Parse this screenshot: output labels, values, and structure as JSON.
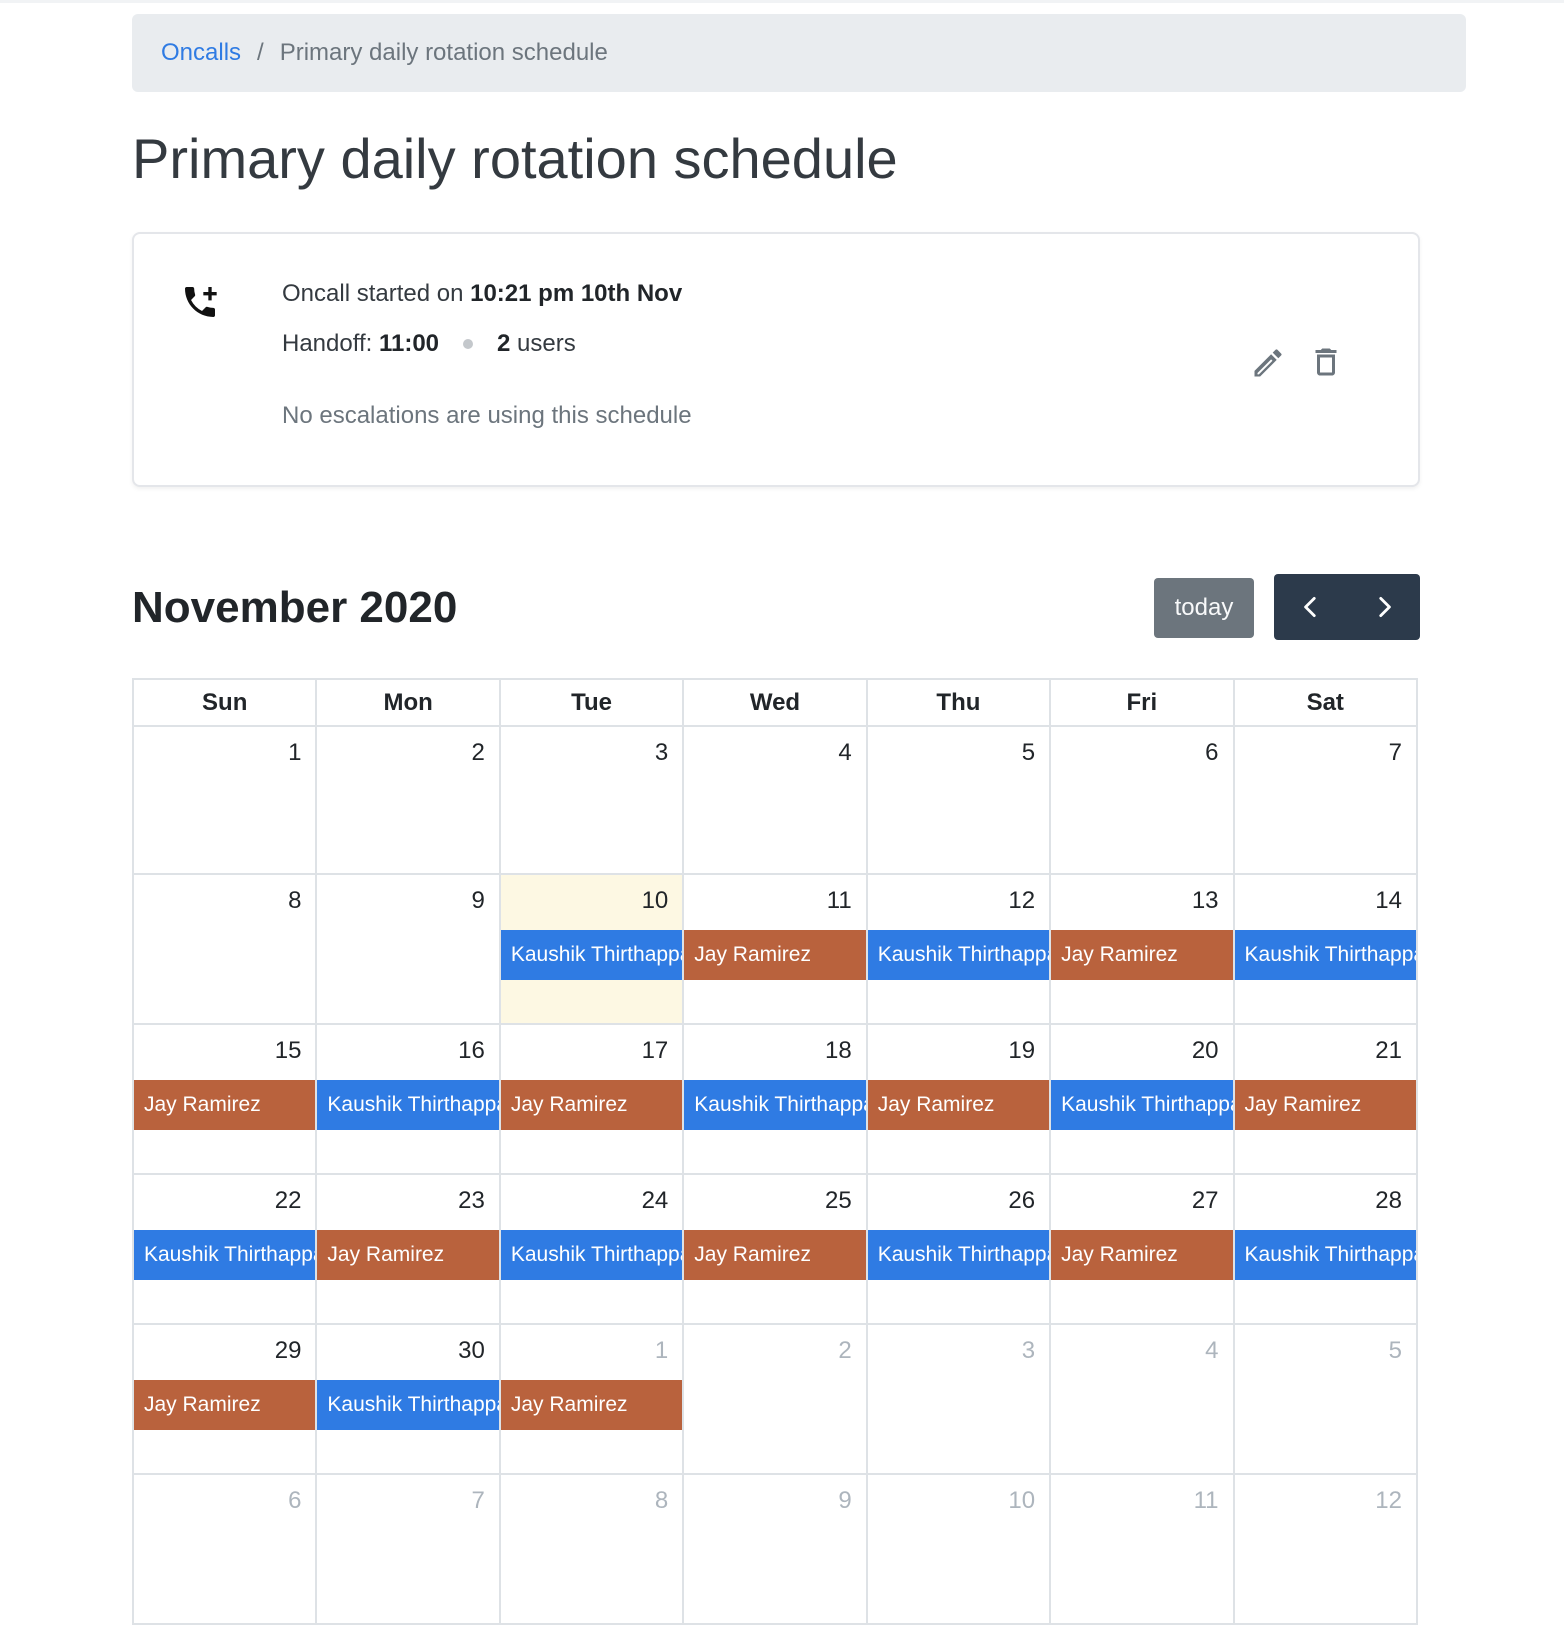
{
  "breadcrumb": {
    "parent": "Oncalls",
    "separator": "/",
    "current": "Primary daily rotation schedule"
  },
  "page_title": "Primary daily rotation schedule",
  "card": {
    "started_prefix": "Oncall started on ",
    "started_value": "10:21 pm 10th Nov",
    "handoff_label": "Handoff: ",
    "handoff_value": "11:00",
    "users_count": "2",
    "users_label": " users",
    "escalations_text": "No escalations are using this schedule",
    "icons": {
      "schedule": "phone-add-icon",
      "edit": "pencil-icon",
      "delete": "trash-icon"
    }
  },
  "calendar": {
    "title": "November 2020",
    "today_label": "today",
    "prev_icon": "chevron-left-icon",
    "next_icon": "chevron-right-icon",
    "weekdays": [
      "Sun",
      "Mon",
      "Tue",
      "Wed",
      "Thu",
      "Fri",
      "Sat"
    ],
    "weeks": [
      [
        {
          "day": "1",
          "other": false,
          "event": null
        },
        {
          "day": "2",
          "other": false,
          "event": null
        },
        {
          "day": "3",
          "other": false,
          "event": null
        },
        {
          "day": "4",
          "other": false,
          "event": null
        },
        {
          "day": "5",
          "other": false,
          "event": null
        },
        {
          "day": "6",
          "other": false,
          "event": null
        },
        {
          "day": "7",
          "other": false,
          "event": null
        }
      ],
      [
        {
          "day": "8",
          "other": false,
          "event": null
        },
        {
          "day": "9",
          "other": false,
          "event": null
        },
        {
          "day": "10",
          "other": false,
          "today": true,
          "event": {
            "name": "Kaushik Thirthappa",
            "color": "blue"
          }
        },
        {
          "day": "11",
          "other": false,
          "event": {
            "name": "Jay Ramirez",
            "color": "orange"
          }
        },
        {
          "day": "12",
          "other": false,
          "event": {
            "name": "Kaushik Thirthappa",
            "color": "blue"
          }
        },
        {
          "day": "13",
          "other": false,
          "event": {
            "name": "Jay Ramirez",
            "color": "orange"
          }
        },
        {
          "day": "14",
          "other": false,
          "event": {
            "name": "Kaushik Thirthappa",
            "color": "blue"
          }
        }
      ],
      [
        {
          "day": "15",
          "other": false,
          "event": {
            "name": "Jay Ramirez",
            "color": "orange"
          }
        },
        {
          "day": "16",
          "other": false,
          "event": {
            "name": "Kaushik Thirthappa",
            "color": "blue"
          }
        },
        {
          "day": "17",
          "other": false,
          "event": {
            "name": "Jay Ramirez",
            "color": "orange"
          }
        },
        {
          "day": "18",
          "other": false,
          "event": {
            "name": "Kaushik Thirthappa",
            "color": "blue"
          }
        },
        {
          "day": "19",
          "other": false,
          "event": {
            "name": "Jay Ramirez",
            "color": "orange"
          }
        },
        {
          "day": "20",
          "other": false,
          "event": {
            "name": "Kaushik Thirthappa",
            "color": "blue"
          }
        },
        {
          "day": "21",
          "other": false,
          "event": {
            "name": "Jay Ramirez",
            "color": "orange"
          }
        }
      ],
      [
        {
          "day": "22",
          "other": false,
          "event": {
            "name": "Kaushik Thirthappa",
            "color": "blue"
          }
        },
        {
          "day": "23",
          "other": false,
          "event": {
            "name": "Jay Ramirez",
            "color": "orange"
          }
        },
        {
          "day": "24",
          "other": false,
          "event": {
            "name": "Kaushik Thirthappa",
            "color": "blue"
          }
        },
        {
          "day": "25",
          "other": false,
          "event": {
            "name": "Jay Ramirez",
            "color": "orange"
          }
        },
        {
          "day": "26",
          "other": false,
          "event": {
            "name": "Kaushik Thirthappa",
            "color": "blue"
          }
        },
        {
          "day": "27",
          "other": false,
          "event": {
            "name": "Jay Ramirez",
            "color": "orange"
          }
        },
        {
          "day": "28",
          "other": false,
          "event": {
            "name": "Kaushik Thirthappa",
            "color": "blue"
          }
        }
      ],
      [
        {
          "day": "29",
          "other": false,
          "event": {
            "name": "Jay Ramirez",
            "color": "orange"
          }
        },
        {
          "day": "30",
          "other": false,
          "event": {
            "name": "Kaushik Thirthappa",
            "color": "blue"
          }
        },
        {
          "day": "1",
          "other": true,
          "event": {
            "name": "Jay Ramirez",
            "color": "orange"
          }
        },
        {
          "day": "2",
          "other": true,
          "event": null
        },
        {
          "day": "3",
          "other": true,
          "event": null
        },
        {
          "day": "4",
          "other": true,
          "event": null
        },
        {
          "day": "5",
          "other": true,
          "event": null
        }
      ],
      [
        {
          "day": "6",
          "other": true,
          "event": null
        },
        {
          "day": "7",
          "other": true,
          "event": null
        },
        {
          "day": "8",
          "other": true,
          "event": null
        },
        {
          "day": "9",
          "other": true,
          "event": null
        },
        {
          "day": "10",
          "other": true,
          "event": null
        },
        {
          "day": "11",
          "other": true,
          "event": null
        },
        {
          "day": "12",
          "other": true,
          "event": null
        }
      ]
    ]
  },
  "colors": {
    "link": "#2f7be3",
    "event_blue": "#2f7be3",
    "event_orange": "#b9623d",
    "today_bg": "#fdf8e3",
    "nav_dark": "#2c3a4b",
    "today_button": "#6c757d"
  }
}
